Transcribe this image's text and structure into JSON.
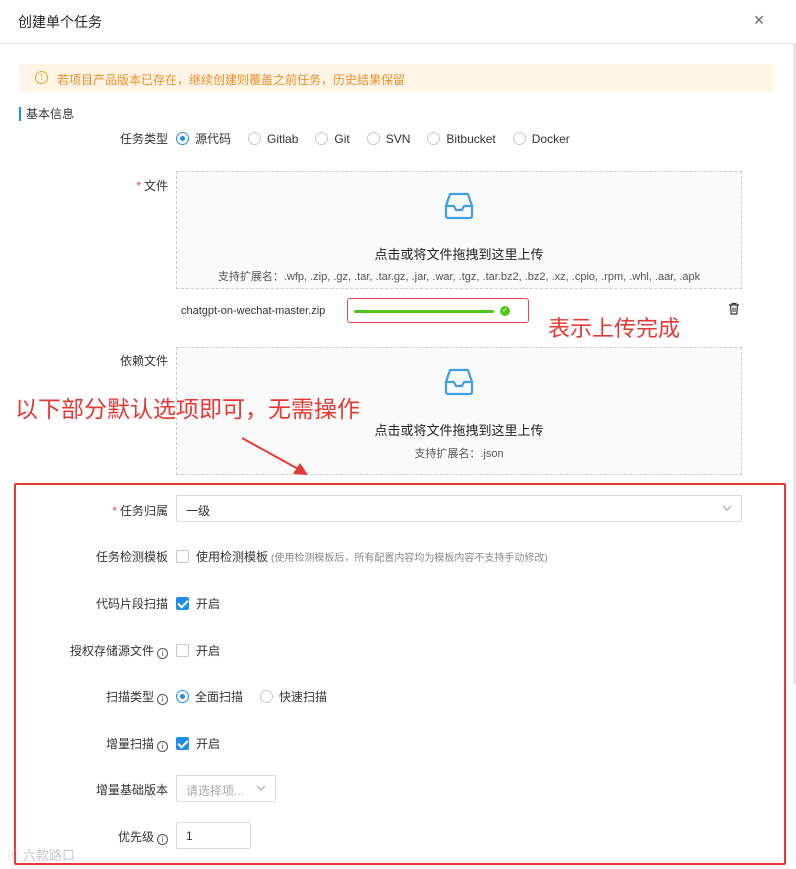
{
  "dialog": {
    "title": "创建单个任务",
    "close_icon": "×"
  },
  "alert": {
    "icon": "!",
    "text": "若项目产品版本已存在，继续创建则覆盖之前任务，历史结果保留"
  },
  "section_title": "基本信息",
  "task_type": {
    "label": "任务类型",
    "options": [
      "源代码",
      "Gitlab",
      "Git",
      "SVN",
      "Bitbucket",
      "Docker"
    ],
    "selected": "源代码"
  },
  "file_field": {
    "required_mark": "*",
    "label": "文件",
    "drop_text": "点击或将文件拖拽到这里上传",
    "ext_text": "支持扩展名：.wfp, .zip, .gz, .tar, .tar.gz, .jar, .war, .tgz, .tar.bz2, .bz2, .xz, .cpio, .rpm, .whl, .aar, .apk",
    "uploaded_file": "chatgpt-on-wechat-master.zip",
    "progress_percent": 100,
    "status_icon": "✓"
  },
  "dep_field": {
    "label": "依赖文件",
    "drop_text": "点击或将文件拖拽到这里上传",
    "ext_text": "支持扩展名：.json"
  },
  "annotations": {
    "upload_done": "表示上传完成",
    "defaults_note": "以下部分默认选项即可，无需操作"
  },
  "task_owner": {
    "required_mark": "*",
    "label": "任务归属",
    "value": "一级"
  },
  "template": {
    "label": "任务检测模板",
    "option_label": "使用检测模板",
    "hint": "(使用检测模板后，所有配置内容均为模板内容不支持手动修改)",
    "checked": false
  },
  "snippet_scan": {
    "label": "代码片段扫描",
    "option_label": "开启",
    "checked": true
  },
  "auth_storage": {
    "label": "授权存储源文件",
    "info_icon": "i",
    "option_label": "开启",
    "checked": false
  },
  "scan_type": {
    "label": "扫描类型",
    "info_icon": "i",
    "options": [
      "全面扫描",
      "快速扫描"
    ],
    "selected": "全面扫描"
  },
  "incremental": {
    "label": "增量扫描",
    "info_icon": "i",
    "option_label": "开启",
    "checked": true
  },
  "base_version": {
    "label": "增量基础版本",
    "placeholder": "请选择项..."
  },
  "priority": {
    "label": "优先级",
    "info_icon": "i",
    "value": "1"
  },
  "watermark": {
    "logo": "ⓒ",
    "text": "六款路口"
  },
  "colors": {
    "accent": "#1f8ee8",
    "annotation": "#e53935",
    "success": "#52c41a",
    "warning": "#e8912c"
  }
}
